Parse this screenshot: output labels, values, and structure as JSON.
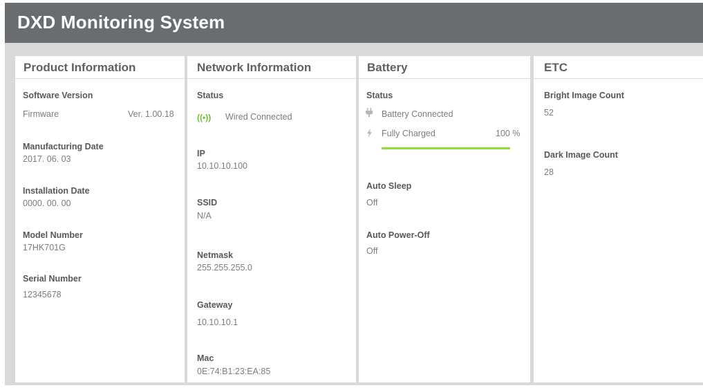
{
  "app": {
    "title": "DXD Monitoring System"
  },
  "product": {
    "title": "Product Information",
    "software_version_label": "Software Version",
    "firmware_label": "Firmware",
    "firmware_value": "Ver. 1.00.18",
    "manufacturing_date_label": "Manufacturing Date",
    "manufacturing_date_value": "2017. 06. 03",
    "installation_date_label": "Installation Date",
    "installation_date_value": "0000. 00. 00",
    "model_number_label": "Model Number",
    "model_number_value": "17HK701G",
    "serial_number_label": "Serial Number",
    "serial_number_value": "12345678"
  },
  "network": {
    "title": "Network Information",
    "status_label": "Status",
    "wifi_glyph": "((•))",
    "status_value": "Wired Connected",
    "ip_label": "IP",
    "ip_value": "10.10.10.100",
    "ssid_label": "SSID",
    "ssid_value": "N/A",
    "netmask_label": "Netmask",
    "netmask_value": "255.255.255.0",
    "gateway_label": "Gateway",
    "gateway_value": "10.10.10.1",
    "mac_label": "Mac",
    "mac_value": "0E:74:B1:23:EA:85"
  },
  "battery": {
    "title": "Battery",
    "status_label": "Status",
    "connected_text": "Battery Connected",
    "charge_text": "Fully Charged",
    "charge_percent_text": "100 %",
    "charge_fraction": 1.0,
    "auto_sleep_label": "Auto Sleep",
    "auto_sleep_value": "Off",
    "auto_poweroff_label": "Auto Power-Off",
    "auto_poweroff_value": "Off",
    "bar_color": "#8ce034"
  },
  "etc": {
    "title": "ETC",
    "bright_label": "Bright Image Count",
    "bright_value": "52",
    "dark_label": "Dark Image Count",
    "dark_value": "28"
  },
  "icons": {
    "wifi": "wifi-signal-icon",
    "plug": "plug-icon",
    "bolt": "lightning-bolt-icon"
  },
  "colors": {
    "header": "#6a6d70",
    "background": "#d7d9da",
    "status_green": "#6cc12c"
  }
}
